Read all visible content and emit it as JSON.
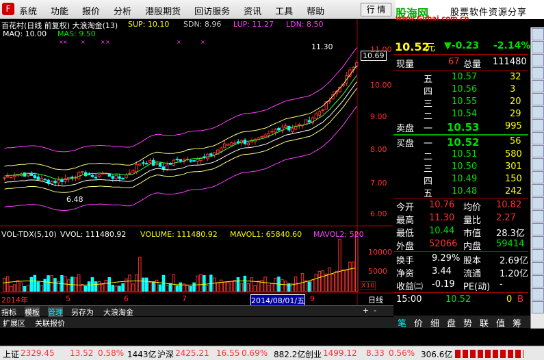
{
  "menu": {
    "logo": "F",
    "items": [
      "系统",
      "功能",
      "报价",
      "分析",
      "港股期货",
      "回访服务",
      "资讯",
      "工具",
      "帮助"
    ],
    "hq": "行 情"
  },
  "brand": {
    "name": "股海网",
    "slogan": "股票软件资源分享",
    "url": "www.Guhai.com.cn"
  },
  "chart": {
    "title": "百花村(日线 前复权) 大浪淘金(13)",
    "sup": "SUP: 10.10",
    "sdn": "SDN: 8.96",
    "lup": "LUP: 11.27",
    "ldn": "LDN: 8.50",
    "maq": "MAQ: 10.00",
    "mas": "MAS: 9.50",
    "price_axis": [
      "11.00",
      "10.00",
      "9.00",
      "8.00",
      "7.00",
      "6.00"
    ],
    "current_tag": "10.69",
    "high_mark": "11.30",
    "low_mark": "6.48",
    "vol_title": "VOL-TDX(5,10)",
    "vvol": "VVOL: 111480.92",
    "volume": "VOLUME: 111480.92",
    "mavol1": "MAVOL1: 65840.60",
    "mavol2": "MAVOL2: 520",
    "vol_axis": [
      "10000",
      "5000"
    ],
    "x10": "X10",
    "date_axis": [
      "2014年",
      "5",
      "6",
      "7",
      "2014/08/01/五",
      "9"
    ],
    "period": "日线"
  },
  "tabs": {
    "items": [
      "指标",
      "模板",
      "管理",
      "另存为",
      "大浪淘金"
    ],
    "row2": [
      "扩展区",
      "关联报价"
    ],
    "plus": "+",
    "minus": "-"
  },
  "quote": {
    "price": "10.52",
    "unit": "元",
    "change": "▼-0.23",
    "pct": "-2.14%",
    "xl_label": "现量",
    "xl": "67",
    "zl_label": "总量",
    "zl": "111480",
    "asks": [
      {
        "l": "五",
        "p": "10.57",
        "v": "32"
      },
      {
        "l": "四",
        "p": "10.56",
        "v": "3"
      },
      {
        "l": "三",
        "p": "10.55",
        "v": "20"
      },
      {
        "l": "二",
        "p": "10.54",
        "v": "29"
      }
    ],
    "ask1_label": "卖盘",
    "ask1_l": "一",
    "ask1_p": "10.53",
    "ask1_v": "995",
    "bid1_label": "买盘",
    "bid1_l": "一",
    "bid1_p": "10.52",
    "bid1_v": "56",
    "bids": [
      {
        "l": "二",
        "p": "10.51",
        "v": "580"
      },
      {
        "l": "三",
        "p": "10.50",
        "v": "301"
      },
      {
        "l": "四",
        "p": "10.49",
        "v": "150"
      },
      {
        "l": "五",
        "p": "10.48",
        "v": "242"
      }
    ],
    "stats": [
      {
        "a": "今开",
        "av": "10.76",
        "b": "均价",
        "bv": "10.82"
      },
      {
        "a": "最高",
        "av": "11.30",
        "b": "量比",
        "bv": "2.27"
      },
      {
        "a": "最低",
        "av": "10.44",
        "b": "市值",
        "bv": "28.3亿"
      },
      {
        "a": "外盘",
        "av": "52066",
        "b": "内盘",
        "bv": "59414"
      }
    ],
    "stats2": [
      {
        "a": "换手",
        "av": "9.29%",
        "b": "股本",
        "bv": "2.69亿"
      },
      {
        "a": "净资",
        "av": "3.44",
        "b": "流通",
        "bv": "1.20亿"
      },
      {
        "a": "收益㈡",
        "av": "-0.19",
        "b": "PE(动)",
        "bv": "-"
      }
    ],
    "tick": {
      "time": "15:00",
      "price": "10.52",
      "vol": "0",
      "side": "B"
    },
    "bottom_tabs": [
      "笔",
      "价",
      "细",
      "盘",
      "势",
      "联",
      "值",
      "筹"
    ]
  },
  "status": {
    "sh_label": "上证",
    "sh": "2329.45",
    "sh_chg": "13.52",
    "sh_pct": "0.58%",
    "sh_amt": "1443亿",
    "sz_label": "沪深",
    "sz": "2425.21",
    "sz_chg": "16.55",
    "sz_pct": "0.69%",
    "sz_amt": "882.2亿",
    "cy_label": "创业",
    "cy": "1499.12",
    "cy_chg": "8.33",
    "cy_pct": "0.56%",
    "cy_amt": "306.6亿"
  },
  "colors": {
    "up": "#ff3030",
    "down": "#00e000",
    "bg": "#000000"
  }
}
